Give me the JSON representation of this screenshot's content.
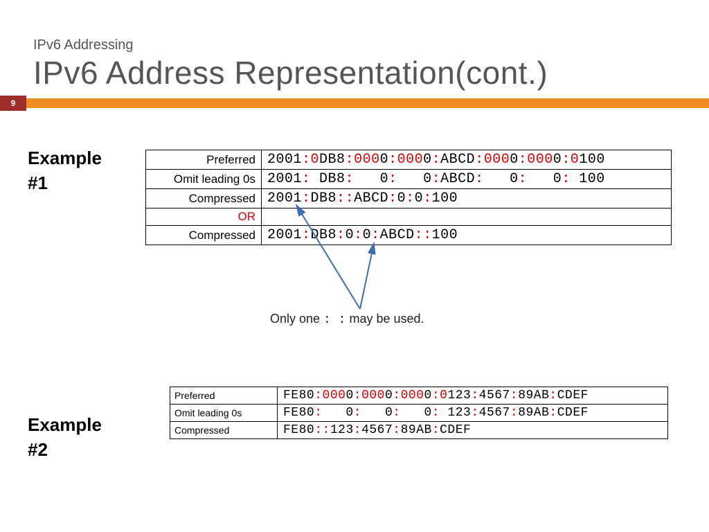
{
  "header": {
    "topic": "IPv6 Addressing",
    "title": "IPv6 Address Representation(cont.)",
    "page_number": "9"
  },
  "example1": {
    "label_line1": "Example",
    "label_line2": "#1",
    "rows": {
      "preferred_label": "Preferred",
      "omit_label": "Omit leading 0s",
      "compressed_label": "Compressed",
      "or_label": "OR"
    },
    "values": {
      "preferred": {
        "segs": [
          "2001",
          "0DB8",
          "0000",
          "0000",
          "ABCD",
          "0000",
          "0000",
          "0100"
        ],
        "red_prefix_len": [
          0,
          1,
          3,
          3,
          0,
          3,
          3,
          1
        ]
      },
      "omit": "2001: DB8:   0:   0:ABCD:   0:   0: 100",
      "compressed_a": "2001:DB8::ABCD:0:0:100",
      "compressed_b": "2001:DB8:0:0:ABCD::100"
    }
  },
  "note": {
    "pre": "Only one ",
    "mono": ": :",
    "post": " may be used."
  },
  "example2": {
    "label_line1": "Example",
    "label_line2": "#2",
    "rows": {
      "preferred_label": "Preferred",
      "omit_label": "Omit leading 0s",
      "compressed_label": "Compressed"
    },
    "values": {
      "preferred": {
        "segs": [
          "FE80",
          "0000",
          "0000",
          "0000",
          "0123",
          "4567",
          "89AB",
          "CDEF"
        ],
        "red_prefix_len": [
          0,
          3,
          3,
          3,
          1,
          0,
          0,
          0
        ]
      },
      "omit": "FE80:   0:   0:   0: 123:4567:89AB:CDEF",
      "compressed": "FE80::123:4567:89AB:CDEF"
    }
  }
}
